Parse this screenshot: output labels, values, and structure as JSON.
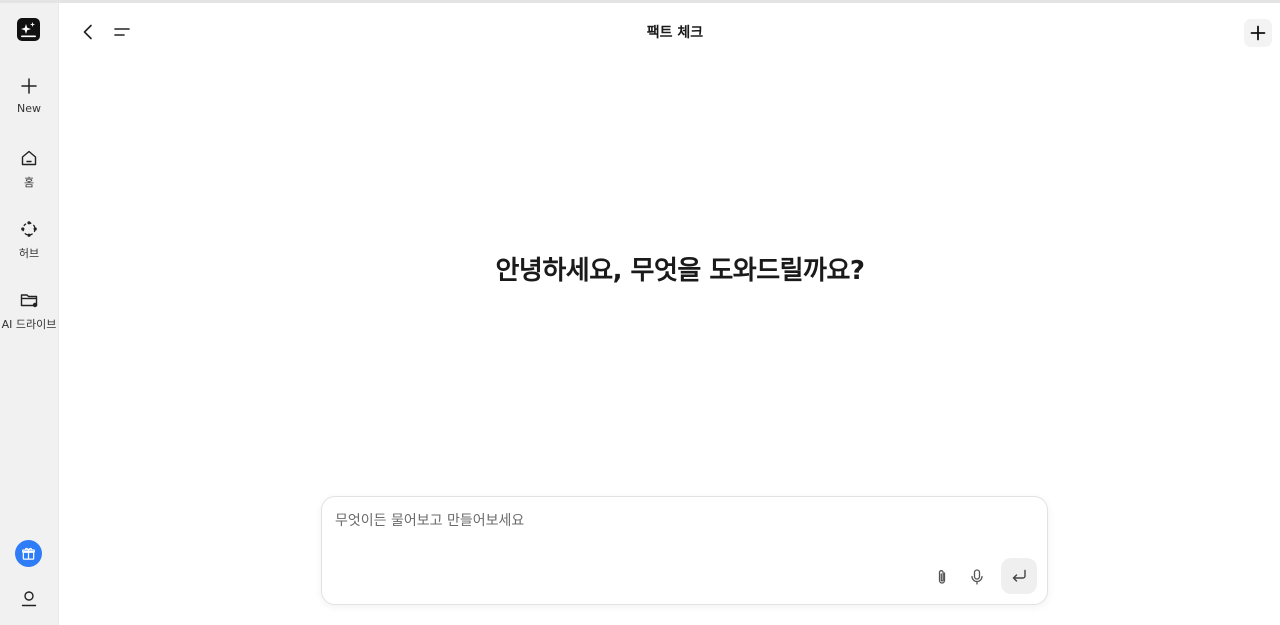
{
  "header": {
    "title": "팩트 체크"
  },
  "sidebar": {
    "items": [
      {
        "label": "New",
        "icon": "plus-icon"
      },
      {
        "label": "홈",
        "icon": "home-icon"
      },
      {
        "label": "허브",
        "icon": "hub-icon"
      },
      {
        "label": "AI 드라이브",
        "icon": "folder-icon"
      }
    ],
    "gift_color": "#2f7df6"
  },
  "main": {
    "greeting": "안녕하세요, 무엇을 도와드릴까요?"
  },
  "composer": {
    "placeholder": "무엇이든 물어보고 만들어보세요",
    "value": ""
  }
}
